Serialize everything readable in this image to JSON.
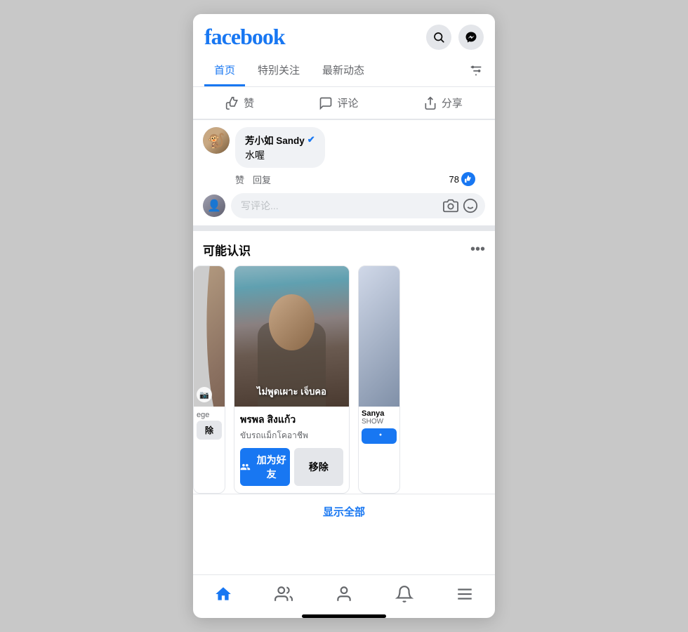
{
  "header": {
    "logo": "facebook",
    "search_icon": "search",
    "messenger_icon": "messenger"
  },
  "nav": {
    "tabs": [
      {
        "label": "首页",
        "active": true
      },
      {
        "label": "特别关注",
        "active": false
      },
      {
        "label": "最新动态",
        "active": false
      }
    ],
    "filter_icon": "filter"
  },
  "actions": {
    "like": "赞",
    "comment": "评论",
    "share": "分享"
  },
  "comment": {
    "name": "芳小如 Sandy",
    "verified": true,
    "text": "水喔",
    "like_label": "赞",
    "reply_label": "回复",
    "like_count": "78",
    "input_placeholder": "写评论..."
  },
  "people_section": {
    "title": "可能认识",
    "show_all": "显示全部",
    "cards": [
      {
        "name": "พรพล สิงแก้ว",
        "subtitle": "ขับรถแม็กโคอาชีพ",
        "add_label": "加为好友",
        "remove_label": "移除",
        "overlay_text": "ไม่พูดเผาะ เจ็บคอ"
      }
    ],
    "right_card": {
      "name": "Sanya",
      "subtitle": "SHOW"
    }
  },
  "bottom_nav": {
    "items": [
      {
        "icon": "home",
        "label": ""
      },
      {
        "icon": "friends",
        "label": ""
      },
      {
        "icon": "profile",
        "label": ""
      },
      {
        "icon": "notifications",
        "label": ""
      },
      {
        "icon": "menu",
        "label": ""
      }
    ]
  }
}
